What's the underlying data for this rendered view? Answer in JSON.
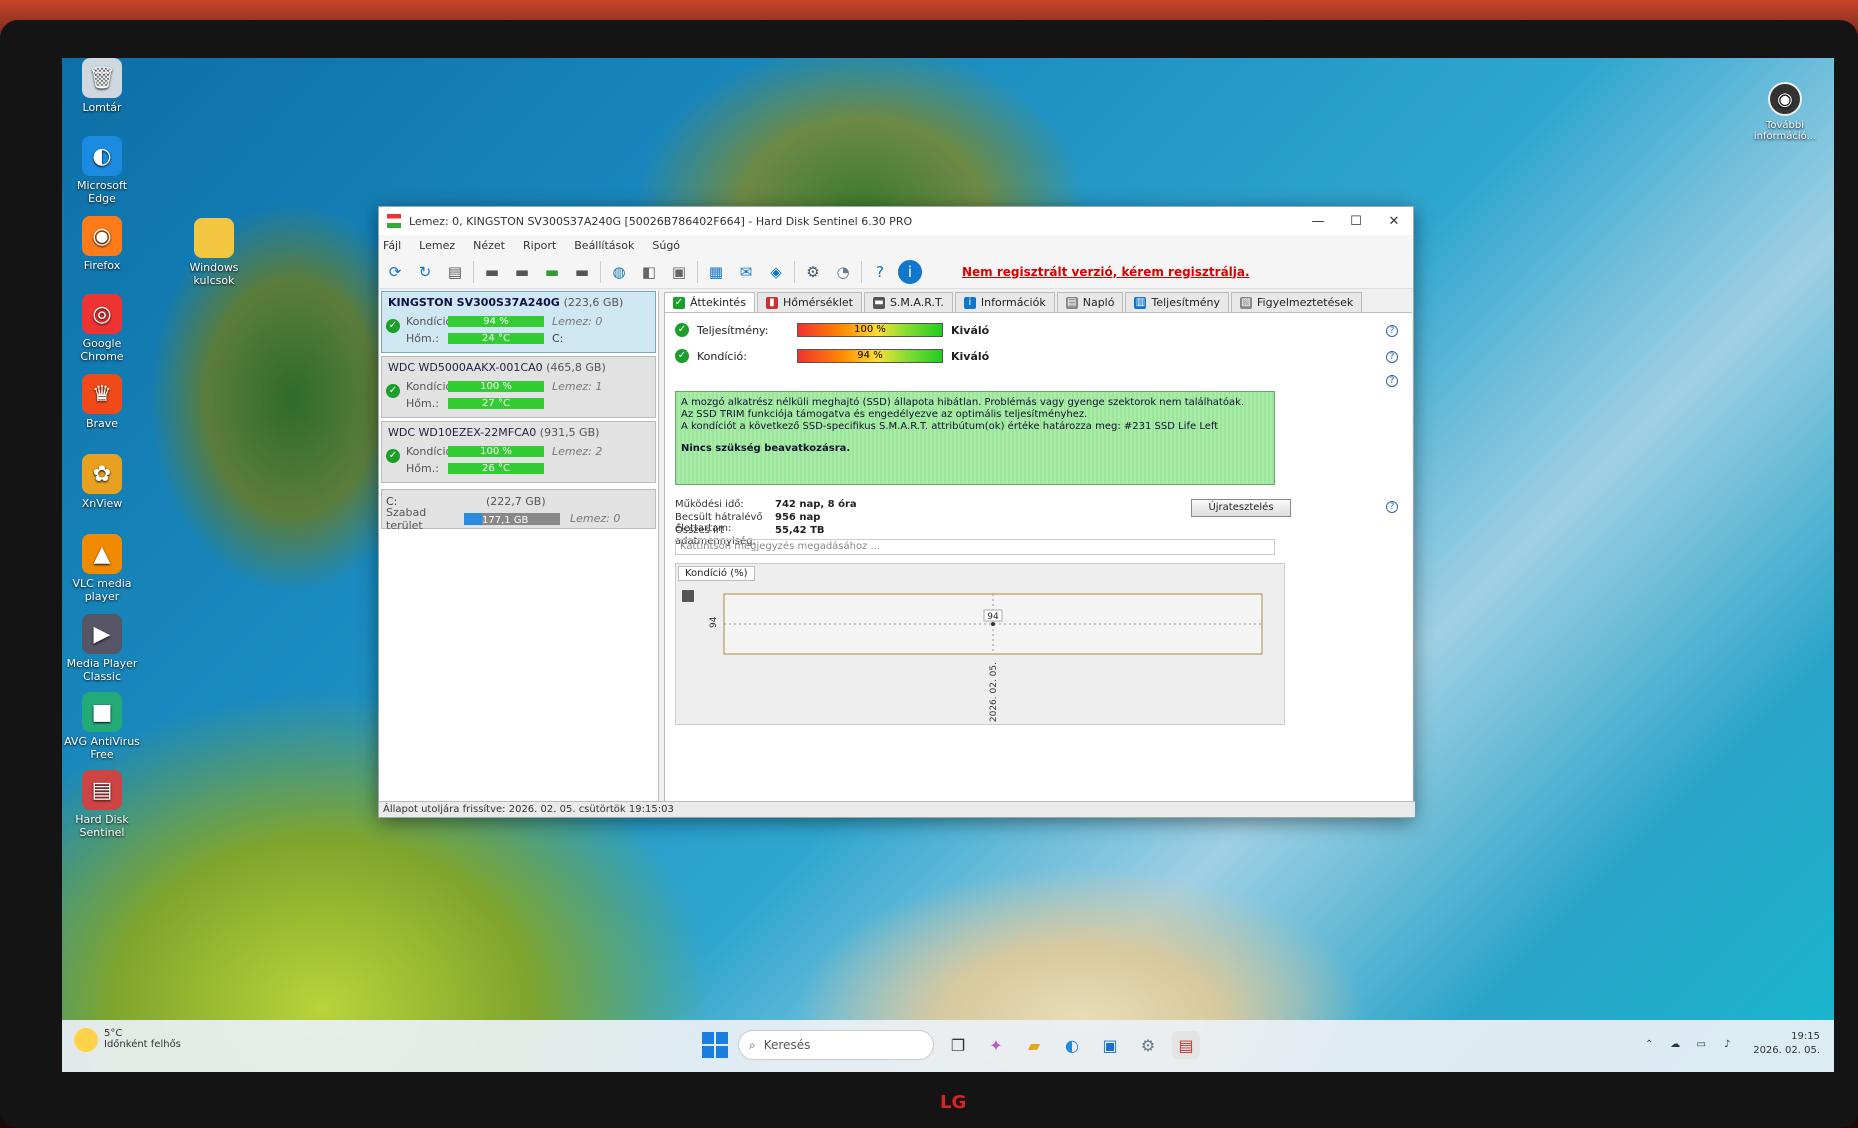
{
  "desktop": {
    "icons": [
      {
        "name": "recycle-bin",
        "label": "Lomtár",
        "glyph": "🗑",
        "color": "#cfd8e0"
      },
      {
        "name": "edge",
        "label": "Microsoft Edge",
        "glyph": "◐",
        "color": "#1a8be0"
      },
      {
        "name": "firefox",
        "label": "Firefox",
        "glyph": "◉",
        "color": "#ff7b1a"
      },
      {
        "name": "chrome",
        "label": "Google Chrome",
        "glyph": "◎",
        "color": "#e33"
      },
      {
        "name": "brave",
        "label": "Brave",
        "glyph": "♛",
        "color": "#f04a1a"
      },
      {
        "name": "xnview",
        "label": "XnView",
        "glyph": "✿",
        "color": "#e8a020"
      },
      {
        "name": "vlc",
        "label": "VLC media player",
        "glyph": "▲",
        "color": "#f08a00"
      },
      {
        "name": "mpc",
        "label": "Media Player Classic",
        "glyph": "▶",
        "color": "#556"
      },
      {
        "name": "avg",
        "label": "AVG AntiVirus Free",
        "glyph": "■",
        "color": "#2a7"
      },
      {
        "name": "hds",
        "label": "Hard Disk Sentinel",
        "glyph": "▤",
        "color": "#c44"
      }
    ],
    "folder": {
      "label": "Windows kulcsok"
    },
    "more_info": "További információ..."
  },
  "window": {
    "title": "Lemez: 0, KINGSTON SV300S37A240G [50026B786402F664]  -  Hard Disk Sentinel 6.30 PRO",
    "controls": {
      "minimize": "—",
      "maximize": "☐",
      "close": "✕"
    },
    "menu": [
      "Fájl",
      "Lemez",
      "Nézet",
      "Riport",
      "Beállítások",
      "Súgó"
    ],
    "register_warning": "Nem regisztrált verzió, kérem regisztrálja.",
    "disks": [
      {
        "name": "KINGSTON SV300S37A240G",
        "size": "(223,6 GB)",
        "health_label": "Kondíció:",
        "health": "94 %",
        "health_pct": 94,
        "temp_label": "Hőm.:",
        "temp": "24 °C",
        "ext1": "Lemez: 0",
        "ext2": "C:",
        "selected": true
      },
      {
        "name": "WDC WD5000AAKX-001CA0",
        "size": "(465,8 GB)",
        "health_label": "Kondíció:",
        "health": "100 %",
        "health_pct": 100,
        "temp_label": "Hőm.:",
        "temp": "27 °C",
        "ext1": "Lemez: 1",
        "ext2": "",
        "selected": false
      },
      {
        "name": "WDC WD10EZEX-22MFCA0",
        "size": "(931,5 GB)",
        "health_label": "Kondíció:",
        "health": "100 %",
        "health_pct": 100,
        "temp_label": "Hőm.:",
        "temp": "26 °C",
        "ext1": "Lemez: 2",
        "ext2": "",
        "selected": false
      }
    ],
    "volume": {
      "drive": "C:",
      "size": "(222,7 GB)",
      "free_label": "Szabad terület",
      "free": "177,1 GB",
      "free_pct": 80,
      "disk": "Lemez: 0"
    },
    "tabs": [
      "Áttekintés",
      "Hőmérséklet",
      "S.M.A.R.T.",
      "Információk",
      "Napló",
      "Teljesítmény",
      "Figyelmeztetések"
    ],
    "performance": {
      "label": "Teljesítmény:",
      "value": "100 %",
      "pct": 100,
      "rating": "Kiváló"
    },
    "health": {
      "label": "Kondíció:",
      "value": "94 %",
      "pct": 94,
      "rating": "Kiváló"
    },
    "info_lines": [
      "A mozgó alkatrész nélküli meghajtó (SSD) állapota hibátlan. Problémás vagy gyenge szektorok nem találhatóak.",
      "Az SSD TRIM funkciója támogatva és engedélyezve az optimális teljesítményhez.",
      "A kondíciót a következő SSD-specifikus S.M.A.R.T. attribútum(ok) értéke határozza meg:  #231 SSD Life Left"
    ],
    "info_action": "Nincs szükség beavatkozásra.",
    "stats": [
      {
        "k": "Működési idő:",
        "v": "742 nap, 8 óra"
      },
      {
        "k": "Becsült hátralévő élettartam:",
        "v": "956 nap"
      },
      {
        "k": "Összes írt adatmennyiség:",
        "v": "55,42 TB"
      }
    ],
    "retest": "Újratesztelés",
    "note_placeholder": "Kattintson megjegyzés megadásához ...",
    "chart_tab": "Kondíció  (%)",
    "status": "Állapot utoljára frissítve: 2026. 02. 05. csütörtök 19:15:03"
  },
  "chart_data": {
    "type": "line",
    "x": [
      "2026. 02. 05."
    ],
    "series": [
      {
        "values": [
          94
        ]
      }
    ],
    "ylabel_tick": "94",
    "data_label": "94"
  },
  "taskbar": {
    "weather_temp": "5°C",
    "weather_desc": "Időnként felhős",
    "search_placeholder": "Keresés",
    "time": "19:15",
    "date": "2026. 02. 05."
  },
  "monitor_brand": "LG"
}
